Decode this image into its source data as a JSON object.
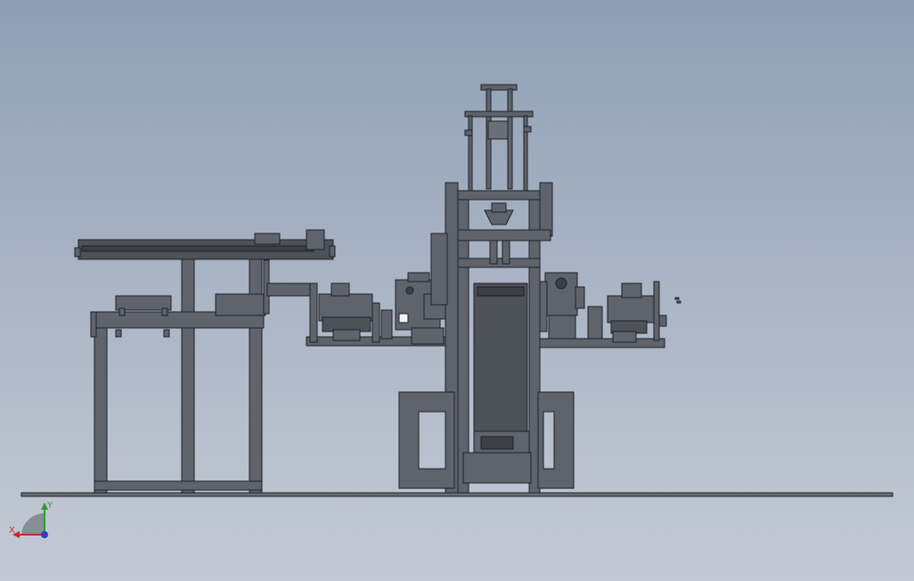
{
  "viewport": {
    "background_top": "#8f9fb3",
    "background_bottom": "#c4cad4",
    "model_color": "#5a5f66",
    "edge_color": "#1e2126"
  },
  "triad": {
    "x_label": "X",
    "y_label": "Y",
    "x_color": "#c42b2b",
    "y_color": "#2f9a3a",
    "z_color": "#2b3fc4"
  }
}
